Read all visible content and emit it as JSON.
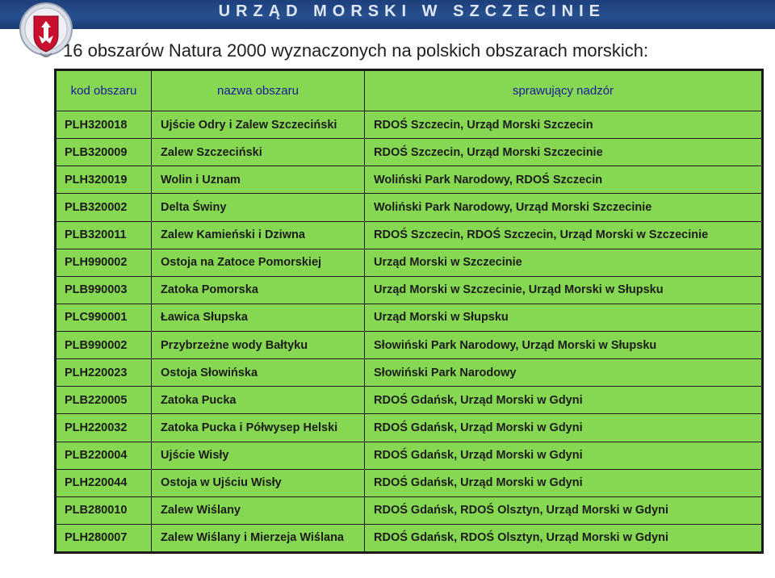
{
  "banner": {
    "title": "URZĄD MORSKI W SZCZECINIE"
  },
  "heading": "16 obszarów Natura 2000 wyznaczonych na polskich obszarach morskich:",
  "colors": {
    "table_bg": "#86d852",
    "header_text": "#1a1a9a",
    "banner": "#27508f"
  },
  "table": {
    "headers": {
      "code": "kod obszaru",
      "name": "nazwa obszaru",
      "supervision": "sprawujący nadzór"
    },
    "rows": [
      {
        "code": "PLH320018",
        "name": "Ujście Odry i Zalew Szczeciński",
        "supervision": "RDOŚ Szczecin, Urząd Morski Szczecin"
      },
      {
        "code": "PLB320009",
        "name": "Zalew Szczeciński",
        "supervision": "RDOŚ Szczecin, Urząd Morski Szczecinie"
      },
      {
        "code": "PLH320019",
        "name": "Wolin i Uznam",
        "supervision": "Woliński Park Narodowy, RDOŚ Szczecin"
      },
      {
        "code": "PLB320002",
        "name": "Delta Świny",
        "supervision": "Woliński Park Narodowy, Urząd Morski Szczecinie"
      },
      {
        "code": "PLB320011",
        "name": "Zalew Kamieński i Dziwna",
        "supervision": "RDOŚ Szczecin, RDOŚ Szczecin, Urząd Morski w Szczecinie"
      },
      {
        "code": "PLH990002",
        "name": "Ostoja na Zatoce Pomorskiej",
        "supervision": "Urząd Morski w Szczecinie"
      },
      {
        "code": "PLB990003",
        "name": "Zatoka Pomorska",
        "supervision": "Urząd Morski w Szczecinie, Urząd Morski w Słupsku"
      },
      {
        "code": "PLC990001",
        "name": "Ławica Słupska",
        "supervision": "Urząd Morski w Słupsku"
      },
      {
        "code": "PLB990002",
        "name": "Przybrzeżne wody Bałtyku",
        "supervision": "Słowiński Park Narodowy, Urząd Morski w Słupsku"
      },
      {
        "code": "PLH220023",
        "name": "Ostoja Słowińska",
        "supervision": "Słowiński Park Narodowy"
      },
      {
        "code": "PLB220005",
        "name": "Zatoka Pucka",
        "supervision": "RDOŚ Gdańsk, Urząd Morski w Gdyni"
      },
      {
        "code": "PLH220032",
        "name": "Zatoka Pucka i Półwysep Helski",
        "supervision": "RDOŚ Gdańsk, Urząd Morski w Gdyni"
      },
      {
        "code": "PLB220004",
        "name": "Ujście Wisły",
        "supervision": "RDOŚ Gdańsk, Urząd Morski w Gdyni"
      },
      {
        "code": "PLH220044",
        "name": "Ostoja w Ujściu Wisły",
        "supervision": "RDOŚ Gdańsk, Urząd Morski w Gdyni"
      },
      {
        "code": "PLB280010",
        "name": "Zalew Wiślany",
        "supervision": "RDOŚ Gdańsk, RDOŚ Olsztyn, Urząd Morski w Gdyni"
      },
      {
        "code": "PLH280007",
        "name": "Zalew Wiślany i Mierzeja Wiślana",
        "supervision": "RDOŚ Gdańsk, RDOŚ Olsztyn, Urząd Morski w Gdyni"
      }
    ]
  }
}
